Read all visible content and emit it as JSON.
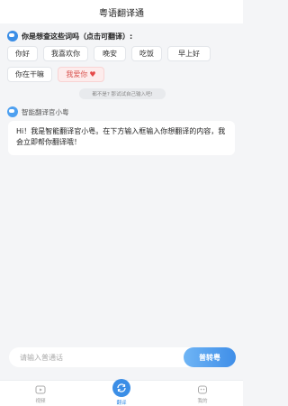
{
  "header": {
    "title": "粤语翻译通"
  },
  "suggestions": {
    "title": "你是想查这些词吗（点击可翻译）:",
    "row1": [
      "你好",
      "我喜欢你",
      "晚安",
      "吃饭",
      "早上好"
    ],
    "row2": [
      "你在干嘛",
      "我爱你"
    ],
    "love_icon": "heart-icon"
  },
  "hint": "都不是? 那试试自己输入吧!",
  "bot": {
    "name": "智能翻译官小粤",
    "message": "Hi！我是智能翻译官小粤。在下方输入框输入你想翻译的内容，我会立即帮你翻译哦！"
  },
  "input": {
    "placeholder": "请输入普通话",
    "value": "",
    "button": "普转粤"
  },
  "tabs": [
    {
      "label": "视频",
      "icon": "video-icon",
      "active": false
    },
    {
      "label": "翻译",
      "icon": "translate-icon",
      "active": true
    },
    {
      "label": "我的",
      "icon": "profile-icon",
      "active": false
    }
  ],
  "colors": {
    "accent": "#3b8ee6",
    "love": "#d9534f"
  }
}
